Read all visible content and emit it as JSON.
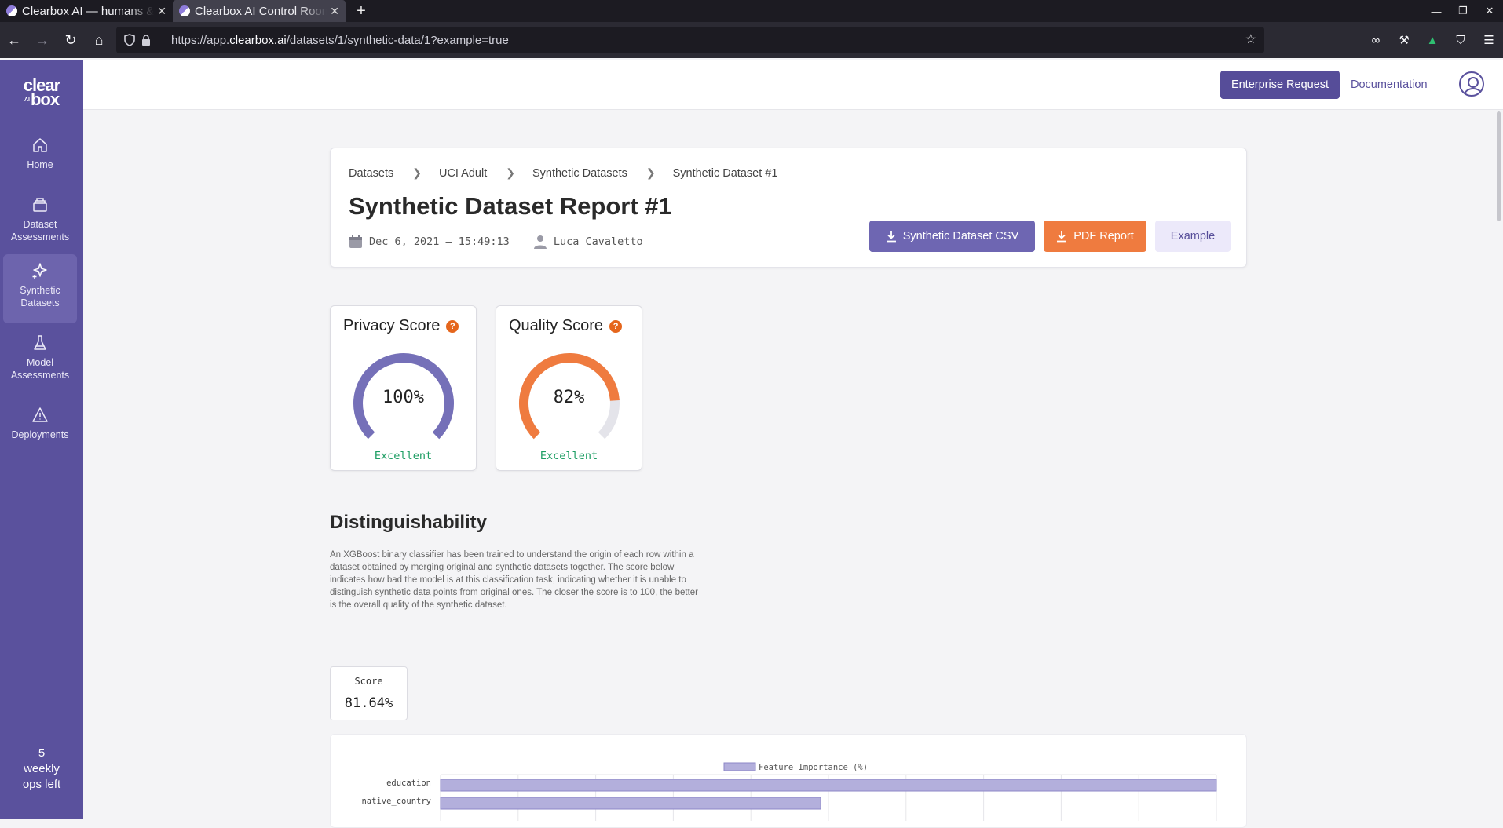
{
  "browser": {
    "tabs": [
      {
        "title": "Clearbox AI — humans &",
        "active": false
      },
      {
        "title": "Clearbox AI Control Room",
        "active": true
      }
    ],
    "url_prefix": "https://app.",
    "url_domain": "clearbox.ai",
    "url_path": "/datasets/1/synthetic-data/1?example=true"
  },
  "sidebar": {
    "logo_top": "clear",
    "logo_small": "AI",
    "logo_bottom": "box",
    "items": [
      {
        "label": "Home",
        "icon": "home-icon"
      },
      {
        "label": "Dataset Assessments",
        "icon": "database-icon"
      },
      {
        "label": "Synthetic Datasets",
        "icon": "sparkles-icon",
        "active": true
      },
      {
        "label": "Model Assessments",
        "icon": "flask-icon"
      },
      {
        "label": "Deployments",
        "icon": "warning-triangle-icon"
      }
    ],
    "ops_count": "5",
    "ops_line1": "weekly",
    "ops_line2": "ops left"
  },
  "header": {
    "enterprise_label": "Enterprise Request",
    "documentation_label": "Documentation"
  },
  "report": {
    "breadcrumbs": [
      "Datasets",
      "UCI Adult",
      "Synthetic Datasets",
      "Synthetic Dataset #1"
    ],
    "title": "Synthetic Dataset Report #1",
    "date": "Dec 6, 2021 – 15:49:13",
    "author": "Luca Cavaletto",
    "csv_label": "Synthetic Dataset CSV",
    "pdf_label": "PDF Report",
    "example_label": "Example"
  },
  "scores": {
    "privacy": {
      "title": "Privacy Score",
      "value": 100,
      "value_text": "100%",
      "rating": "Excellent",
      "color": "#7570b8"
    },
    "quality": {
      "title": "Quality Score",
      "value": 82,
      "value_text": "82%",
      "rating": "Excellent",
      "color": "#ef7b3f"
    }
  },
  "distinguishability": {
    "title": "Distinguishability",
    "description": "An XGBoost binary classifier has been trained to understand the origin of each row within a dataset obtained by merging original and synthetic datasets together. The score below indicates how bad the model is at this classification task, indicating whether it is unable to distinguish synthetic data points from original ones. The closer the score is to 100, the better is the overall quality of the synthetic dataset.",
    "score_label": "Score",
    "score_value": "81.64%"
  },
  "chart_data": {
    "type": "bar",
    "orientation": "horizontal",
    "legend": "Feature Importance (%)",
    "categories": [
      "education",
      "native_country"
    ],
    "values": [
      100,
      49
    ],
    "xlim": [
      0,
      100
    ],
    "color": "#b3afdc"
  }
}
